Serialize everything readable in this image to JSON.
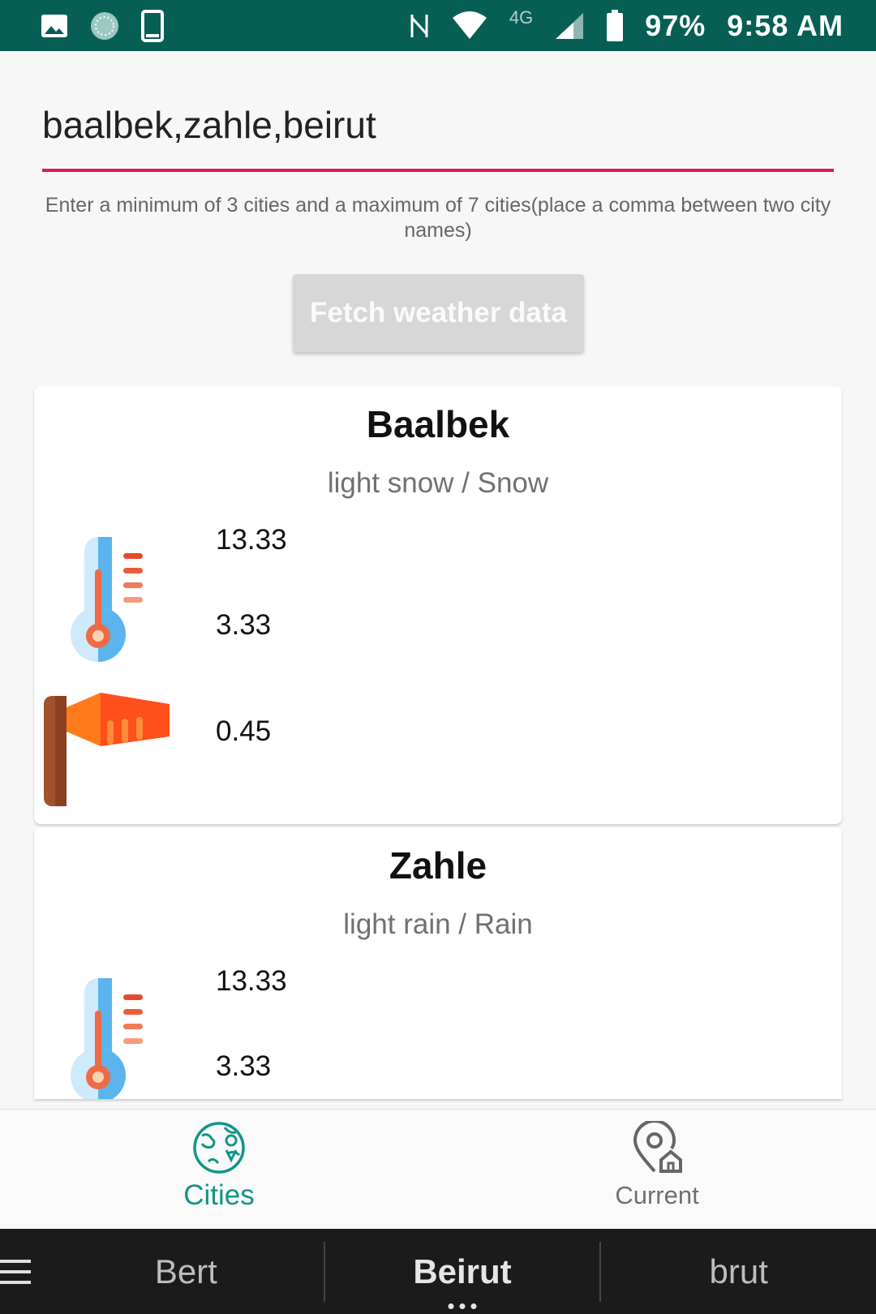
{
  "status": {
    "battery": "97%",
    "time": "9:58 AM",
    "network": "4G"
  },
  "search": {
    "value": "baalbek,zahle,beirut",
    "helper": "Enter a minimum of 3 cities and a maximum of 7 cities(place a comma between two city names)"
  },
  "fetch_button": {
    "label": "Fetch weather data"
  },
  "cards": [
    {
      "city": "Baalbek",
      "description": "light snow / Snow",
      "temp": "13.33",
      "temp2": "3.33",
      "wind": "0.45"
    },
    {
      "city": "Zahle",
      "description": "light rain / Rain",
      "temp": "13.33",
      "temp2": "3.33"
    }
  ],
  "nav": {
    "cities": "Cities",
    "current": "Current"
  },
  "suggestions": [
    "Bert",
    "Beirut",
    "brut"
  ],
  "colors": {
    "status_bar": "#075e54",
    "accent": "#d81b60",
    "nav_active": "#129488"
  }
}
